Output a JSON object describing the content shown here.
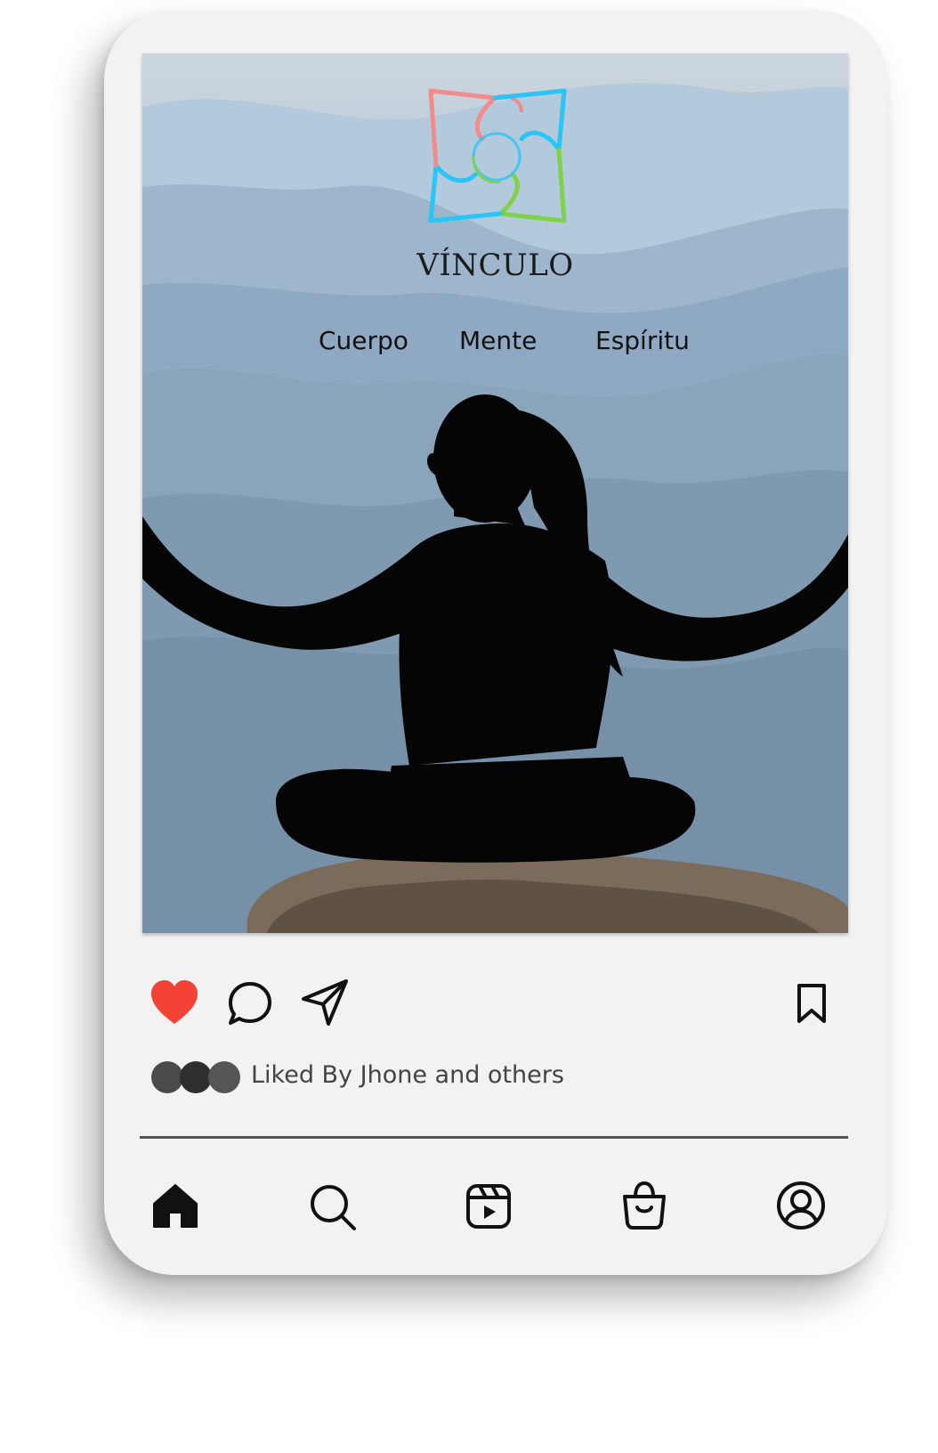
{
  "post": {
    "brand_name": "VÍNCULO",
    "nav": [
      "Cuerpo",
      "Mente",
      "Espíritu"
    ],
    "image": "meditation-silhouette-mountains"
  },
  "actions": {
    "like_icon": "heart-icon",
    "comment_icon": "comment-icon",
    "share_icon": "send-icon",
    "save_icon": "bookmark-icon",
    "liked": true
  },
  "likes": {
    "text": "Liked By Jhone and others"
  },
  "tabbar": {
    "items": [
      "home-icon",
      "search-icon",
      "reels-icon",
      "shop-icon",
      "profile-icon"
    ]
  },
  "colors": {
    "like_red": "#f44336",
    "logo_pink": "#f28b8b",
    "logo_cyan": "#29c5f6",
    "logo_green": "#7ed348",
    "device_body": "#f2f2f2"
  }
}
